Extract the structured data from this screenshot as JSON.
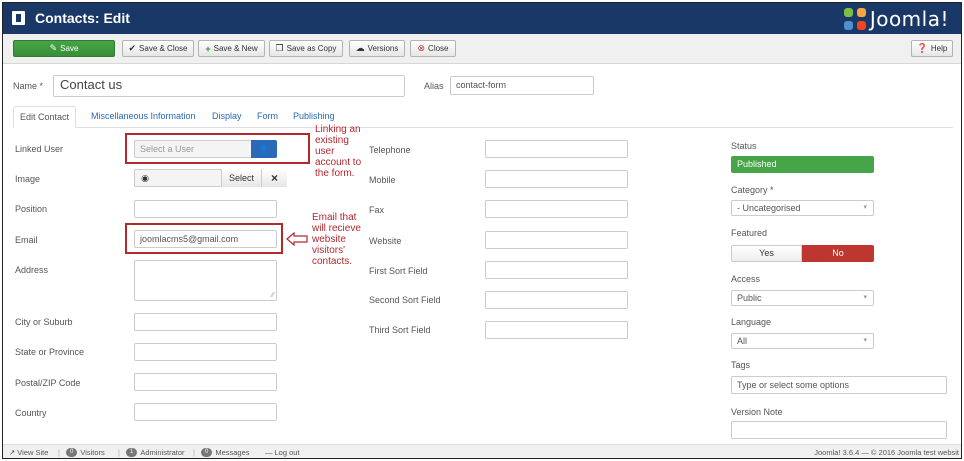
{
  "header": {
    "title": "Contacts: Edit",
    "logo_text": "Joomla!"
  },
  "toolbar": {
    "save": "Save",
    "save_close": "Save & Close",
    "save_new": "Save & New",
    "save_copy": "Save as Copy",
    "versions": "Versions",
    "close": "Close",
    "help": "Help"
  },
  "title_row": {
    "name_label": "Name *",
    "name_value": "Contact us",
    "alias_label": "Alias",
    "alias_value": "contact-form"
  },
  "tabs": [
    "Edit Contact",
    "Miscellaneous Information",
    "Display",
    "Form",
    "Publishing"
  ],
  "left_form": {
    "linked_user_label": "Linked User",
    "linked_user_placeholder": "Select a User",
    "image_label": "Image",
    "image_select": "Select",
    "position_label": "Position",
    "email_label": "Email",
    "email_value": "joomlacms5@gmail.com",
    "address_label": "Address",
    "city_label": "City or Suburb",
    "state_label": "State or Province",
    "postal_label": "Postal/ZIP Code",
    "country_label": "Country"
  },
  "mid_form": {
    "telephone": "Telephone",
    "mobile": "Mobile",
    "fax": "Fax",
    "website": "Website",
    "first_sort": "First Sort Field",
    "second_sort": "Second Sort Field",
    "third_sort": "Third Sort Field"
  },
  "annotations": {
    "linked_user_note": [
      "Linking an",
      "existing",
      "user",
      "account to",
      "the form."
    ],
    "email_note": [
      "Email that",
      "will recieve",
      "website",
      "visitors'",
      "contacts."
    ],
    "color": "#b3282d"
  },
  "sidebar": {
    "status_label": "Status",
    "status_value": "Published",
    "category_label": "Category *",
    "category_value": "- Uncategorised",
    "featured_label": "Featured",
    "featured_yes": "Yes",
    "featured_no": "No",
    "access_label": "Access",
    "access_value": "Public",
    "language_label": "Language",
    "language_value": "All",
    "tags_label": "Tags",
    "tags_placeholder": "Type or select some options",
    "version_note_label": "Version Note"
  },
  "footer": {
    "view_site": "View Site",
    "visitors_count": "0",
    "visitors": "Visitors",
    "admin_count": "1",
    "administrator": "Administrator",
    "messages_count": "0",
    "messages": "Messages",
    "logout": "Log out",
    "copyright": "Joomla! 3.6.4 — © 2016 Joomla test websit"
  },
  "colors": {
    "header_bg": "#1a3867",
    "save_green": "#47a447",
    "published_green": "#46a546",
    "no_red": "#bd362f",
    "link_blue": "#2a69b8"
  }
}
